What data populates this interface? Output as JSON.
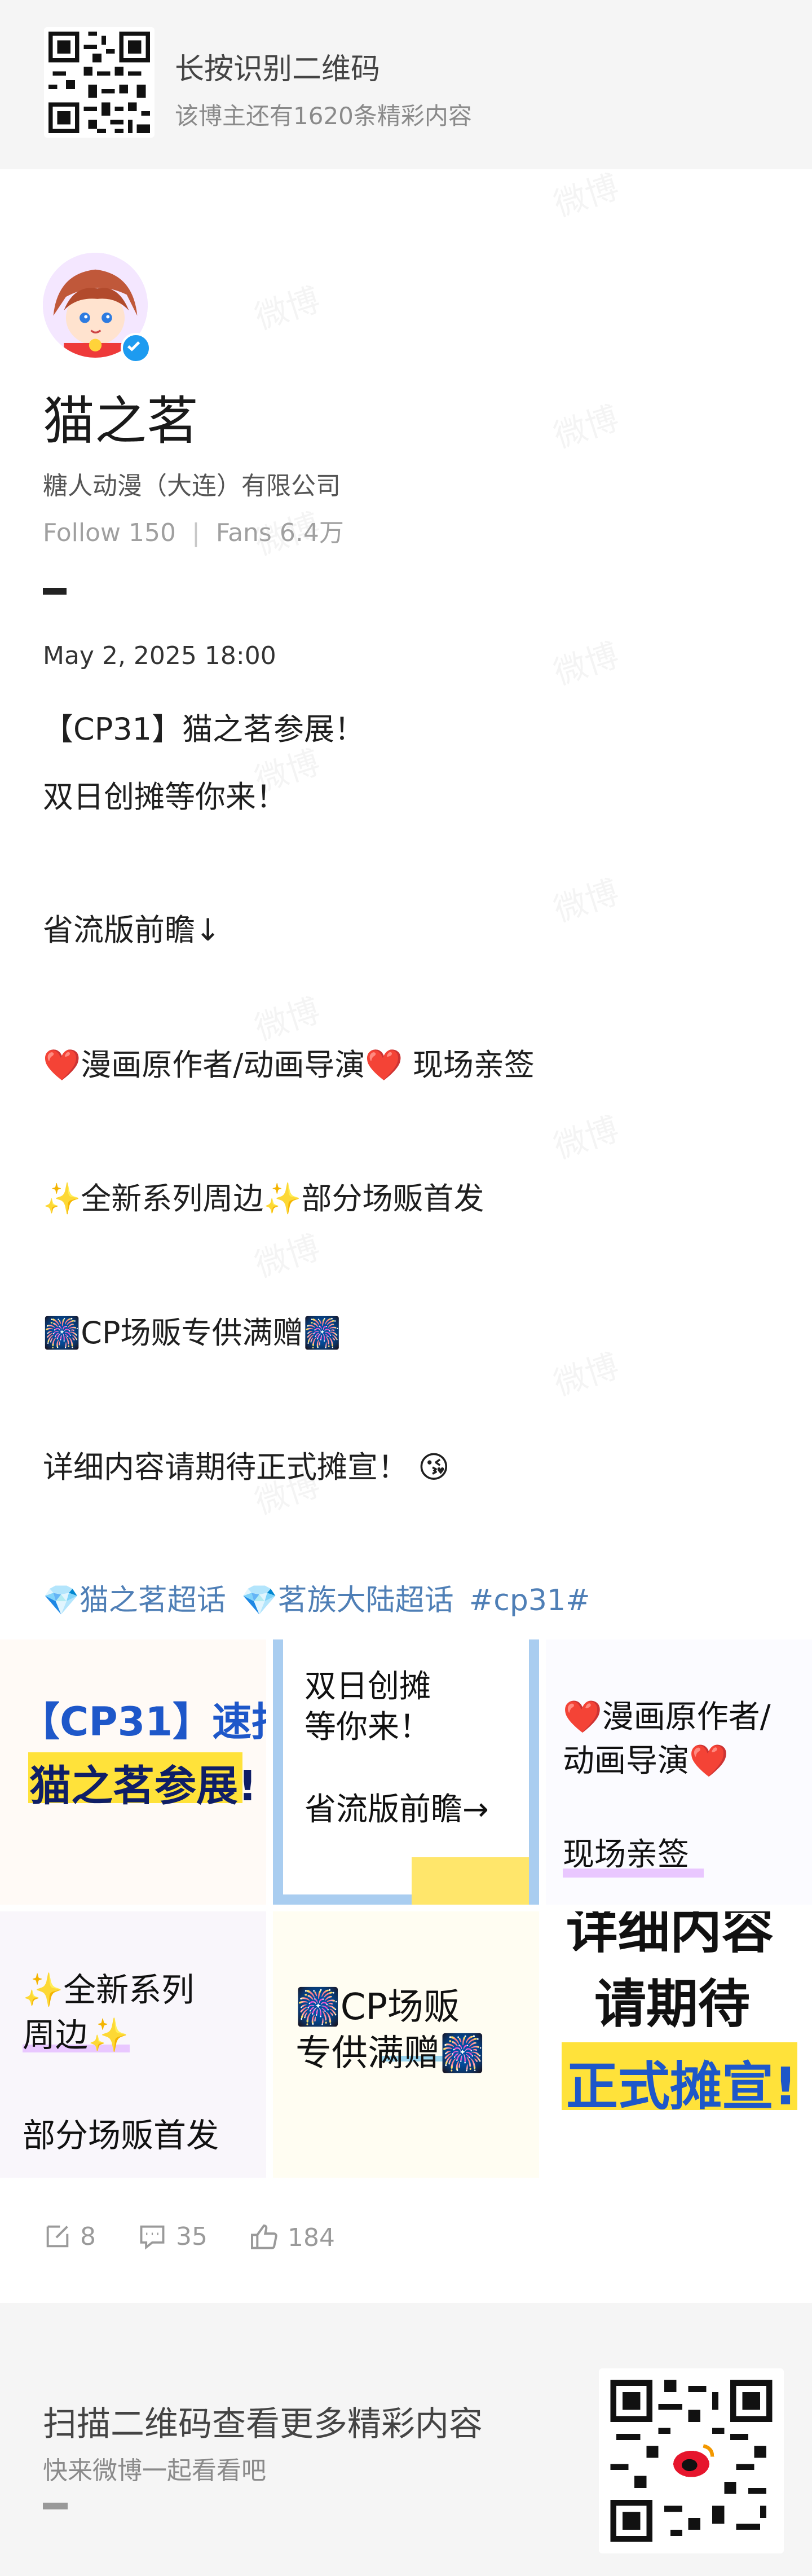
{
  "header": {
    "title": "长按识别二维码",
    "subtitle": "该博主还有1620条精彩内容"
  },
  "watermark": "微博",
  "profile": {
    "name": "猫之茗",
    "company": "糖人动漫（大连）有限公司",
    "follow": "Follow 150",
    "separator": "|",
    "fans": "Fans 6.4万",
    "verified_color": "#1d9bf0"
  },
  "post": {
    "date": "May 2, 2025 18:00",
    "lines": [
      "【CP31】猫之茗参展！",
      "双日创摊等你来！",
      "省流版前瞻↓",
      "❤️漫画原作者/动画导演❤️ 现场亲签",
      "✨全新系列周边✨部分场贩首发",
      "🎆CP场贩专供满赠🎆",
      "详细内容请期待正式摊宣！ 😘"
    ],
    "tags": [
      "💎猫之茗超话",
      "💎茗族大陆超话",
      "#cp31#"
    ]
  },
  "images": {
    "tile1": {
      "line1_a": "【CP31】",
      "line1_b": "速报!",
      "line2": "猫之茗参展!"
    },
    "tile2": {
      "line1": "双日创摊",
      "line2": "等你来！",
      "line3": "省流版前瞻→"
    },
    "tile3": {
      "line1": "❤️漫画原作者/",
      "line2": "动画导演❤️",
      "line3": "现场亲签"
    },
    "tile4": {
      "line1": "✨全新系列",
      "line2": "周边✨",
      "line3": "部分场贩首发"
    },
    "tile5": {
      "line1": "🎆CP场贩",
      "line2": "专供满赠🎆"
    },
    "tile6": {
      "line1": "详细内容",
      "line2": "请期待",
      "line3": "正式摊宣!"
    }
  },
  "actions": {
    "repost": "8",
    "comment": "35",
    "like": "184"
  },
  "footer": {
    "title": "扫描二维码查看更多精彩内容",
    "subtitle": "快来微博一起看看吧"
  },
  "colors": {
    "accent_blue": "#4f7fb6",
    "header_bg": "#f5f5f5",
    "tile_yellow": "#ffe23a",
    "tile_blue_border": "#a9cdf0"
  }
}
